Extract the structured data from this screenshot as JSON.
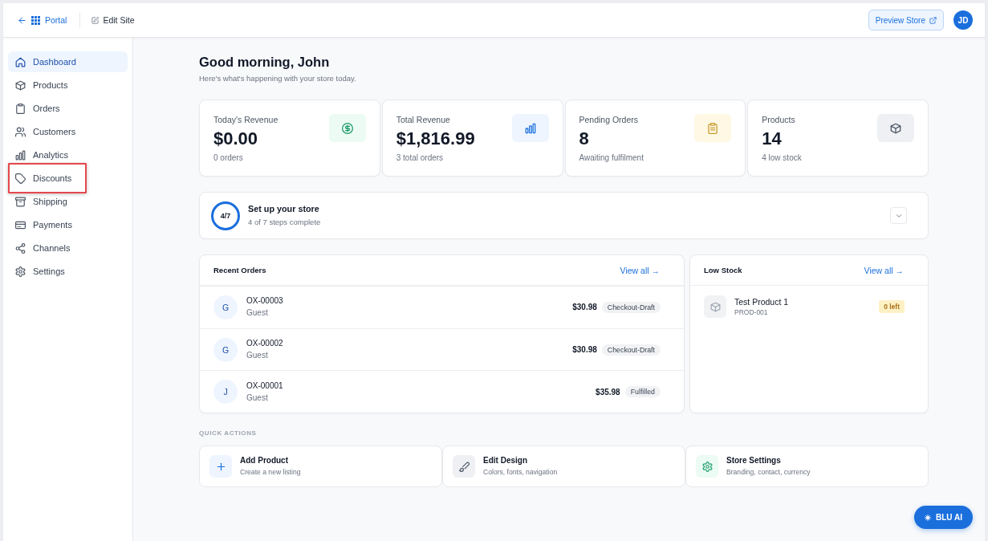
{
  "top_bar": {
    "back_label": "Portal",
    "edit_label": "Edit Site",
    "preview_button": "Preview Store",
    "avatar_initials": "JD"
  },
  "sidebar": {
    "items": [
      {
        "label": "Dashboard",
        "selected": true,
        "highlighted": false
      },
      {
        "label": "Products",
        "selected": false,
        "highlighted": false
      },
      {
        "label": "Orders",
        "selected": false,
        "highlighted": false
      },
      {
        "label": "Customers",
        "selected": false,
        "highlighted": false
      },
      {
        "label": "Analytics",
        "selected": false,
        "highlighted": false
      },
      {
        "label": "Discounts",
        "selected": false,
        "highlighted": true
      },
      {
        "label": "Shipping",
        "selected": false,
        "highlighted": false
      },
      {
        "label": "Payments",
        "selected": false,
        "highlighted": false
      },
      {
        "label": "Channels",
        "selected": false,
        "highlighted": false
      },
      {
        "label": "Settings",
        "selected": false,
        "highlighted": false
      }
    ]
  },
  "greeting": {
    "title": "Good morning, John",
    "subtitle": "Here's what's happening with your store today."
  },
  "stats": [
    {
      "label": "Today's Revenue",
      "value": "$0.00",
      "note": "0 orders"
    },
    {
      "label": "Total Revenue",
      "value": "$1,816.99",
      "note": "3 total orders"
    },
    {
      "label": "Pending Orders",
      "value": "8",
      "note": "Awaiting fulfilment"
    },
    {
      "label": "Products",
      "value": "14",
      "note": "4 low stock"
    }
  ],
  "setup": {
    "progress": "4/7",
    "title": "Set up your store",
    "subtitle": "4 of 7 steps complete",
    "expanded": false
  },
  "recent_orders": {
    "title": "Recent Orders",
    "view_all": "View all →",
    "rows": [
      {
        "initial": "G",
        "order": "OX-00003",
        "customer": "Guest",
        "amount": "$30.98",
        "status": "Checkout-Draft"
      },
      {
        "initial": "G",
        "order": "OX-00002",
        "customer": "Guest",
        "amount": "$30.98",
        "status": "Checkout-Draft"
      },
      {
        "initial": "J",
        "order": "OX-00001",
        "customer": "Guest",
        "amount": "$35.98",
        "status": "Fulfilled"
      }
    ]
  },
  "low_stock": {
    "title": "Low Stock",
    "view_all": "View all →",
    "rows": [
      {
        "name": "Test Product 1",
        "sku": "PROD-001",
        "stock": "0 left"
      }
    ]
  },
  "quick_actions": {
    "heading": "QUICK ACTIONS",
    "items": [
      {
        "title": "Add Product",
        "subtitle": "Create a new listing"
      },
      {
        "title": "Edit Design",
        "subtitle": "Colors, fonts, navigation"
      },
      {
        "title": "Store Settings",
        "subtitle": "Branding, contact, currency"
      }
    ]
  },
  "assistant_button": "BLU AI"
}
